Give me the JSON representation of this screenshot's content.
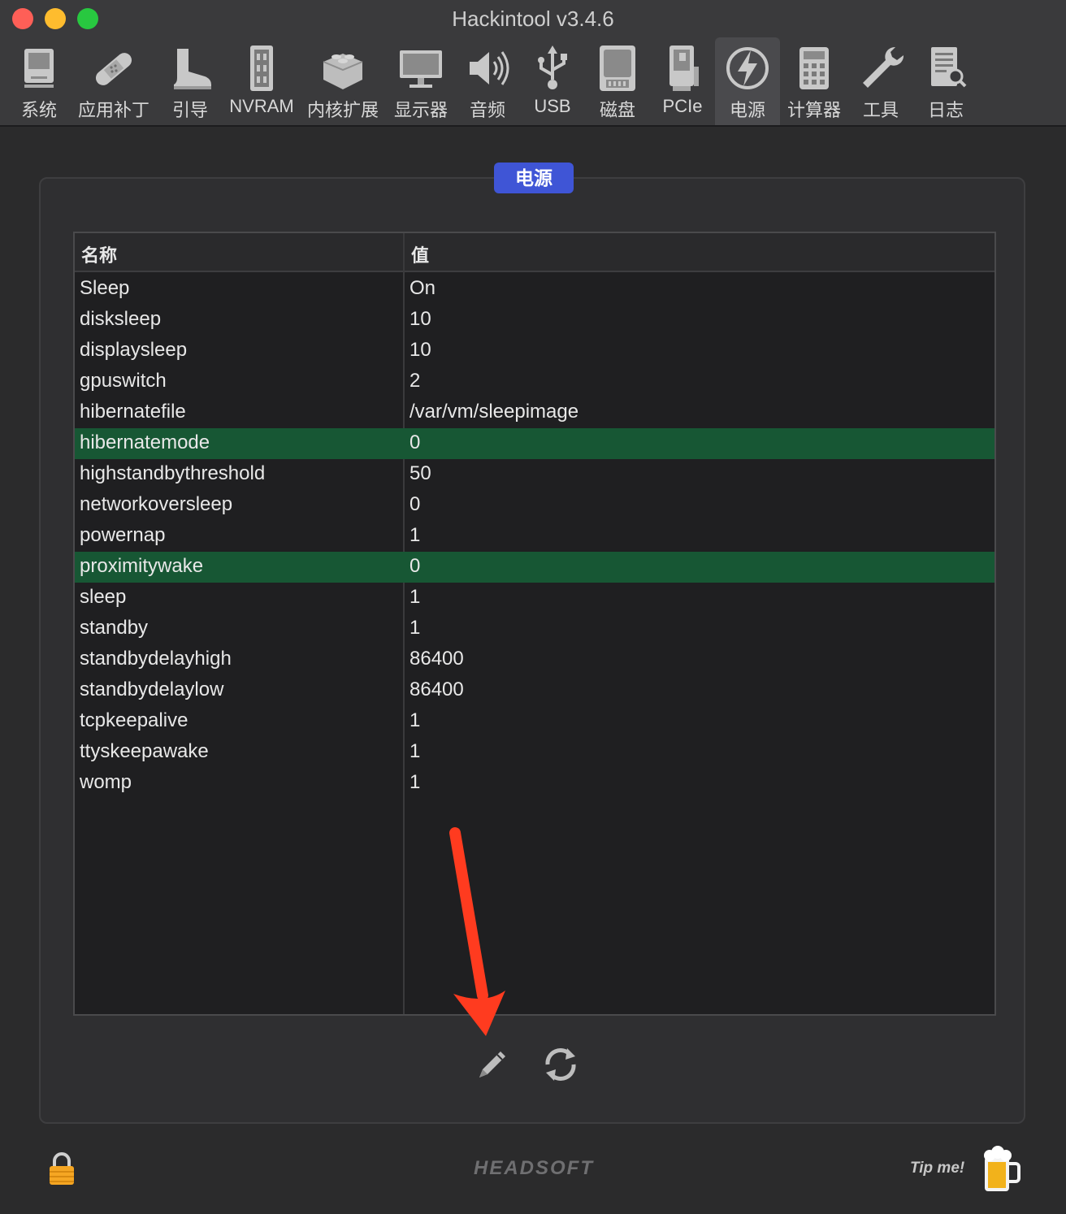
{
  "window": {
    "title": "Hackintool v3.4.6"
  },
  "toolbar": {
    "items": [
      {
        "label": "系统",
        "icon": "system-icon"
      },
      {
        "label": "应用补丁",
        "icon": "patch-bandage-icon"
      },
      {
        "label": "引导",
        "icon": "boot-icon"
      },
      {
        "label": "NVRAM",
        "icon": "nvram-chip-icon"
      },
      {
        "label": "内核扩展",
        "icon": "kext-brick-icon"
      },
      {
        "label": "显示器",
        "icon": "display-icon"
      },
      {
        "label": "音频",
        "icon": "speaker-icon"
      },
      {
        "label": "USB",
        "icon": "usb-icon"
      },
      {
        "label": "磁盘",
        "icon": "disk-icon"
      },
      {
        "label": "PCIe",
        "icon": "pcie-card-icon"
      },
      {
        "label": "电源",
        "icon": "power-bolt-icon",
        "active": true
      },
      {
        "label": "计算器",
        "icon": "calculator-icon"
      },
      {
        "label": "工具",
        "icon": "wrench-icon"
      },
      {
        "label": "日志",
        "icon": "log-document-icon"
      }
    ]
  },
  "group": {
    "title": "电源"
  },
  "table": {
    "headers": {
      "name": "名称",
      "value": "值"
    },
    "rows": [
      {
        "name": "Sleep",
        "value": "On"
      },
      {
        "name": "disksleep",
        "value": "10"
      },
      {
        "name": "displaysleep",
        "value": "10"
      },
      {
        "name": "gpuswitch",
        "value": "2"
      },
      {
        "name": "hibernatefile",
        "value": "/var/vm/sleepimage"
      },
      {
        "name": "hibernatemode",
        "value": "0",
        "highlight": true
      },
      {
        "name": "highstandbythreshold",
        "value": "50"
      },
      {
        "name": "networkoversleep",
        "value": "0"
      },
      {
        "name": "powernap",
        "value": "1"
      },
      {
        "name": "proximitywake",
        "value": "0",
        "highlight": true
      },
      {
        "name": "sleep",
        "value": "1"
      },
      {
        "name": "standby",
        "value": "1"
      },
      {
        "name": "standbydelayhigh",
        "value": "86400"
      },
      {
        "name": "standbydelaylow",
        "value": "86400"
      },
      {
        "name": "tcpkeepalive",
        "value": "1"
      },
      {
        "name": "ttyskeepawake",
        "value": "1"
      },
      {
        "name": "womp",
        "value": "1"
      }
    ]
  },
  "footer": {
    "brand": "HEADSOFT",
    "tip": "Tip me!"
  },
  "colors": {
    "accent": "#3f55d6",
    "row_highlight": "#175734",
    "annotation_arrow": "#ff3b1f"
  }
}
